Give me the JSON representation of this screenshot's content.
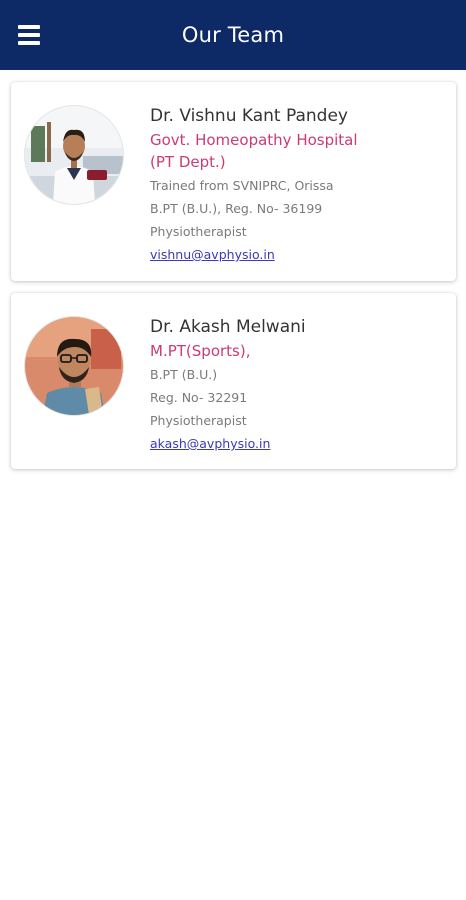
{
  "header": {
    "title": "Our Team",
    "menu_icon": "hamburger-menu-icon",
    "background": "#0d2a66"
  },
  "team": [
    {
      "name": "Dr. Vishnu Kant Pandey",
      "subtitle_lines": [
        "Govt. Homeopathy Hospital",
        "(PT Dept.)"
      ],
      "details": [
        "Trained from SVNIPRC, Orissa",
        "B.PT (B.U.), Reg. No- 36199",
        "Physiotherapist"
      ],
      "email": "vishnu@avphysio.in"
    },
    {
      "name": "Dr. Akash Melwani",
      "subtitle_lines": [
        "M.PT(Sports),"
      ],
      "details": [
        "B.PT (B.U.)",
        "Reg. No- 32291",
        "Physiotherapist"
      ],
      "email": "akash@avphysio.in"
    }
  ],
  "colors": {
    "accent": "#c2185b",
    "link": "#3a3ab5"
  }
}
